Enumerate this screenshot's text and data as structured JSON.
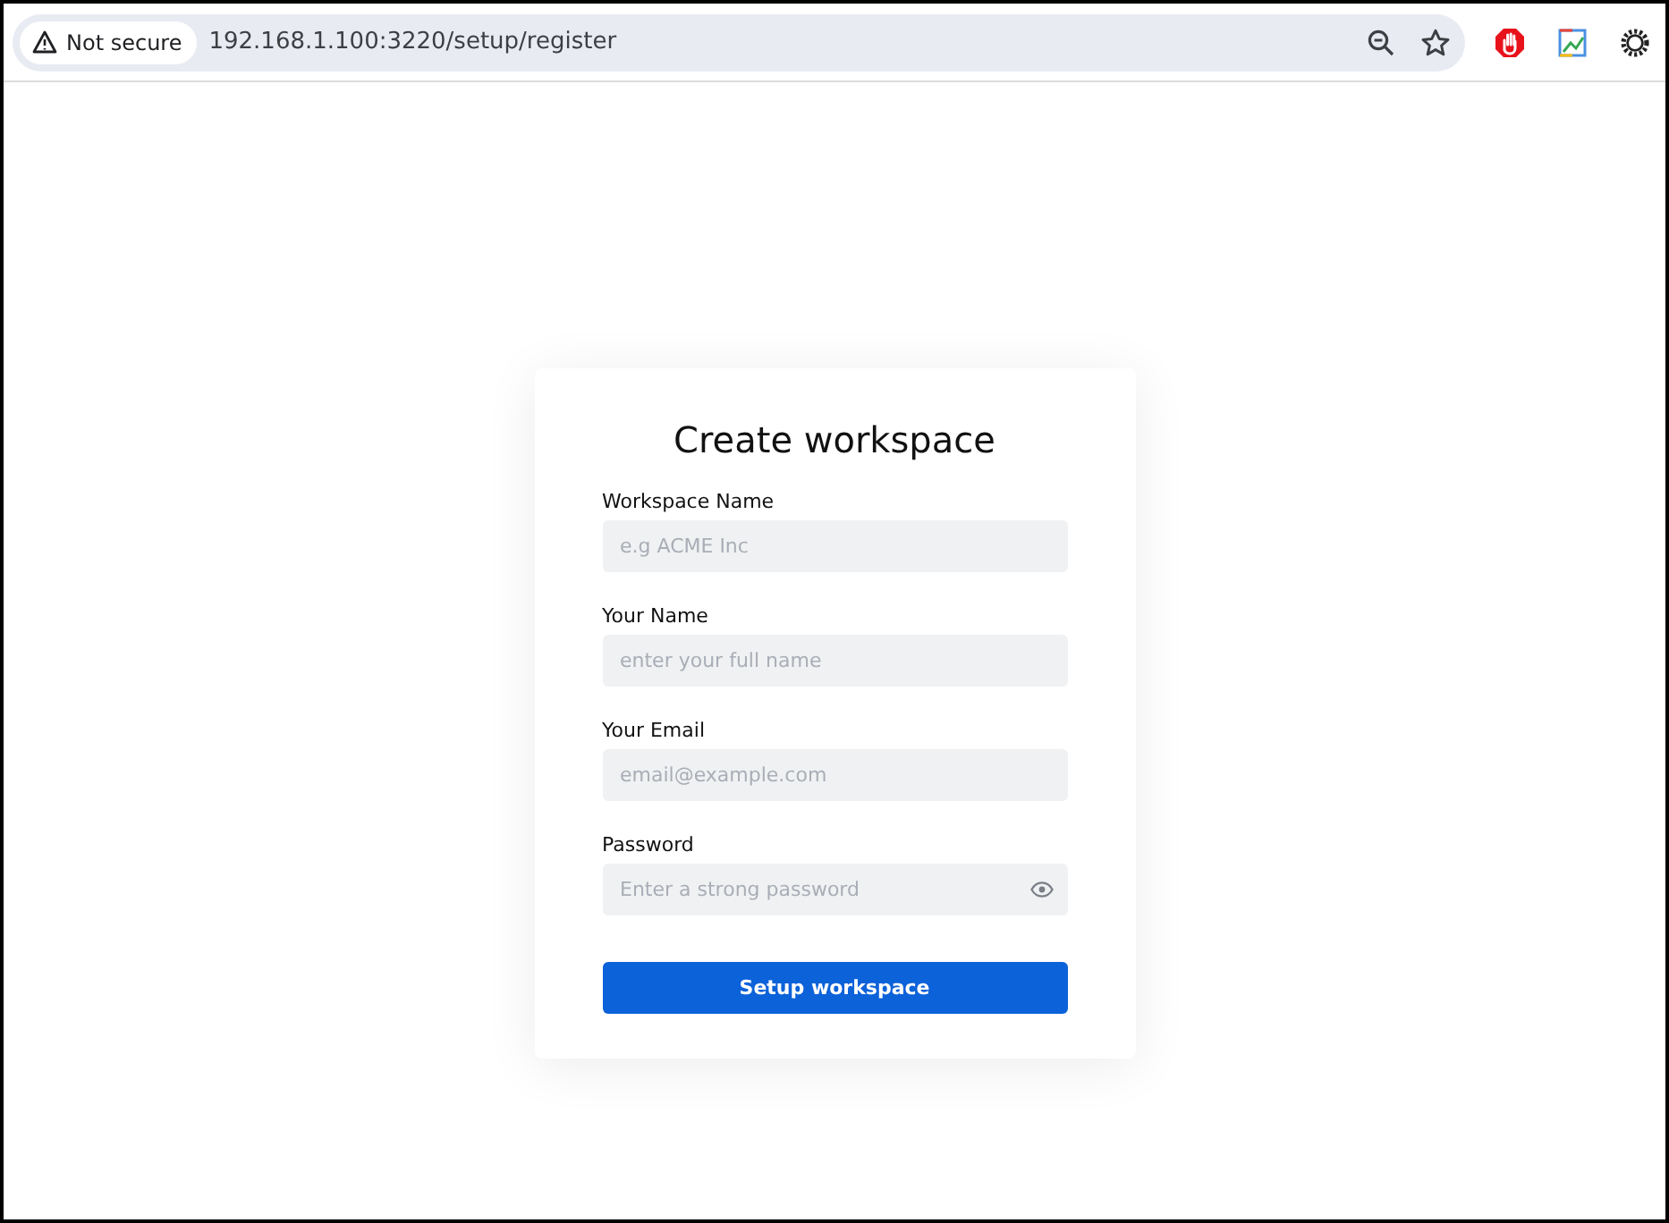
{
  "browser": {
    "security_label": "Not secure",
    "url": "192.168.1.100:3220/setup/register"
  },
  "form": {
    "title": "Create workspace",
    "fields": [
      {
        "label": "Workspace Name",
        "placeholder": "e.g ACME Inc",
        "kind": "text"
      },
      {
        "label": "Your Name",
        "placeholder": "enter your full name",
        "kind": "text"
      },
      {
        "label": "Your Email",
        "placeholder": "email@example.com",
        "kind": "email"
      },
      {
        "label": "Password",
        "placeholder": "Enter a strong password",
        "kind": "password"
      }
    ],
    "button": "Setup workspace"
  }
}
